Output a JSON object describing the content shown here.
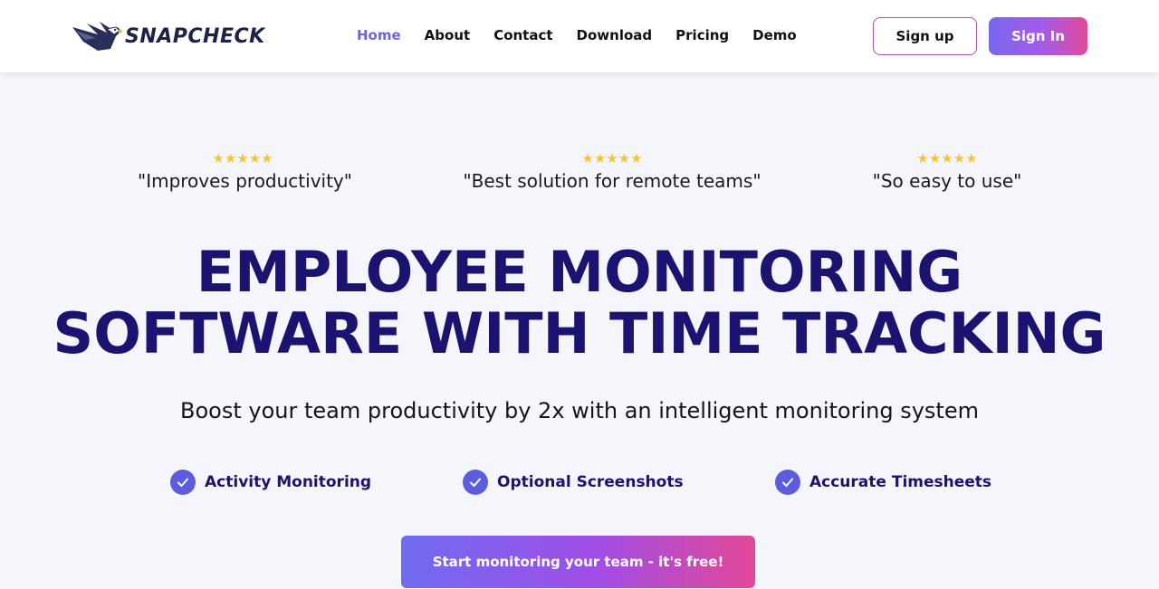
{
  "brand": {
    "name": "SNAPCHECK",
    "logo_icon": "eagle-icon"
  },
  "nav": {
    "items": [
      {
        "label": "Home",
        "active": true
      },
      {
        "label": "About",
        "active": false
      },
      {
        "label": "Contact",
        "active": false
      },
      {
        "label": "Download",
        "active": false
      },
      {
        "label": "Pricing",
        "active": false
      },
      {
        "label": "Demo",
        "active": false
      }
    ]
  },
  "auth": {
    "signup_label": "Sign up",
    "signin_label": "Sign In"
  },
  "testimonials": [
    {
      "stars": "★★★★★",
      "rating": 5,
      "quote": "\"Improves productivity\""
    },
    {
      "stars": "★★★★★",
      "rating": 5,
      "quote": "\"Best solution for remote teams\""
    },
    {
      "stars": "★★★★★",
      "rating": 5,
      "quote": "\"So easy to use\""
    }
  ],
  "hero": {
    "title_line1": "EMPLOYEE MONITORING",
    "title_line2": "SOFTWARE WITH TIME TRACKING",
    "subtitle": "Boost your team productivity by 2x with an intelligent monitoring system"
  },
  "features": [
    {
      "icon": "check-circle-icon",
      "label": "Activity Monitoring"
    },
    {
      "icon": "check-circle-icon",
      "label": "Optional Screenshots"
    },
    {
      "icon": "check-circle-icon",
      "label": "Accurate Timesheets"
    }
  ],
  "cta": {
    "label": "Start monitoring your team - it's free!"
  },
  "colors": {
    "accent": "#6b63e8",
    "heading": "#1c1270",
    "star": "#f7c534",
    "gradient_start": "#6f6cf0",
    "gradient_end": "#e24897"
  }
}
